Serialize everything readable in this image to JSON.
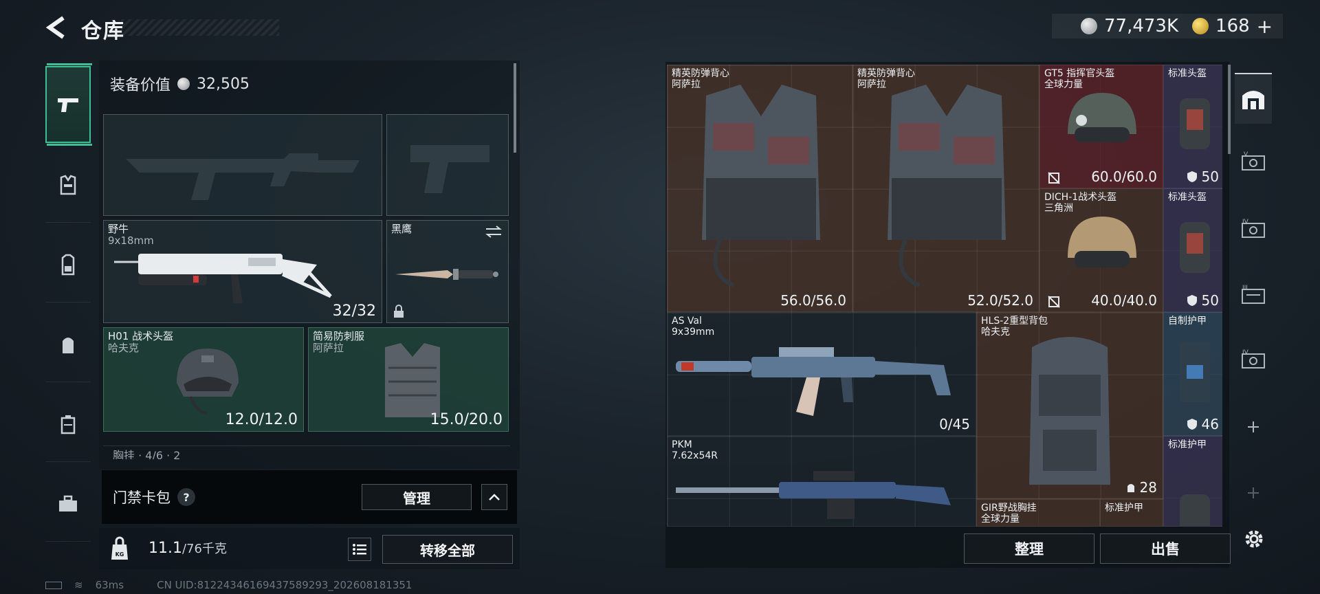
{
  "header": {
    "title": "仓库",
    "silver": "77,473K",
    "gold": "168",
    "plus": "+"
  },
  "equip": {
    "label": "装备价值",
    "value": "32,505"
  },
  "slots": {
    "primary2": {
      "name": "野牛",
      "sub": "9x18mm",
      "value": "32/32"
    },
    "knife": {
      "name": "黑鹰"
    },
    "helmet": {
      "name": "H01 战术头盔",
      "sub": "哈夫克",
      "value": "12.0/12.0"
    },
    "armor": {
      "name": "简易防刺服",
      "sub": "阿萨拉",
      "value": "15.0/20.0"
    },
    "next_row": "胸挂 · 4/6 · 2"
  },
  "card_pack": {
    "label": "门禁卡包",
    "help": "?",
    "manage": "管理"
  },
  "bottom": {
    "weight": "11.1",
    "weight_max": "/76千克",
    "transfer": "转移全部"
  },
  "status": {
    "ping": "63ms",
    "uid": "CN UID:8122434616943758929​3_202608181351"
  },
  "stash": {
    "vest1": {
      "name": "精英防弹背心",
      "sub": "阿萨拉",
      "value": "56.0/56.0"
    },
    "vest2": {
      "name": "精英防弹背心",
      "sub": "阿萨拉",
      "value": "52.0/52.0"
    },
    "helmet_gt5": {
      "name": "GT5 指挥官头盔",
      "sub": "全球力量",
      "value": "60.0/60.0"
    },
    "std_helmet1": {
      "name": "标准头盔",
      "value": "50"
    },
    "helmet_dich": {
      "name": "DICH-1战术头盔",
      "sub": "三角洲",
      "value": "40.0/40.0"
    },
    "std_helmet2": {
      "name": "标准头盔",
      "value": "50"
    },
    "asval": {
      "name": "AS Val",
      "sub": "9x39mm",
      "value": "0/45"
    },
    "backpack": {
      "name": "HLS-2重型背包",
      "sub": "哈夫克",
      "value": "28"
    },
    "diy_armor": {
      "name": "自制护甲",
      "value": "46"
    },
    "std_armor1": {
      "name": "标准护甲"
    },
    "pkm": {
      "name": "PKM",
      "sub": "7.62x54R"
    },
    "gir_rig": {
      "name": "GIR野战胸挂",
      "sub": "全球力量"
    },
    "std_armor2": {
      "name": "标准护甲"
    }
  },
  "actions": {
    "sort": "整理",
    "sell": "出售"
  },
  "colors": {
    "accent": "#3fbf96"
  }
}
